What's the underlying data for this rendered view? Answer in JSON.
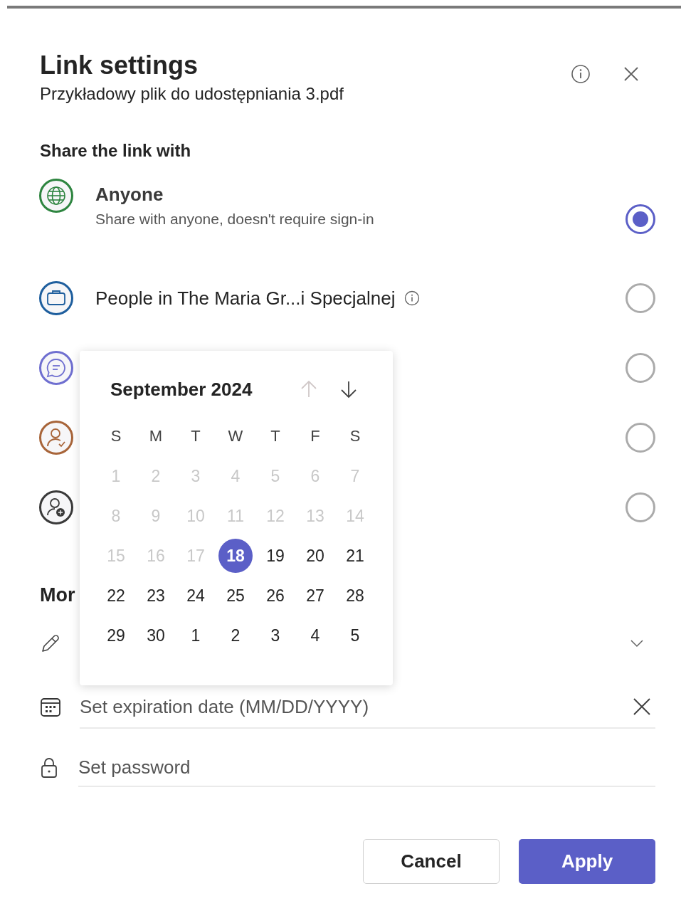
{
  "dialog": {
    "title": "Link settings",
    "subtitle": "Przykładowy plik do udostępniania 3.pdf"
  },
  "share_section": {
    "heading": "Share the link with",
    "options": [
      {
        "kind": "globe",
        "color": "#2e8540",
        "title": "Anyone",
        "description": "Share with anyone, doesn't require sign-in",
        "has_info": false,
        "selected": true
      },
      {
        "kind": "briefcase",
        "color": "#1f5f9e",
        "title": "People in The Maria Gr...i Specjalnej",
        "has_info": true,
        "selected": false
      },
      {
        "kind": "chat",
        "color": "#6f6fd0",
        "selected": false
      },
      {
        "kind": "person",
        "color": "#a8653a",
        "selected": false
      },
      {
        "kind": "people",
        "color": "#3a3a3a",
        "selected": false
      }
    ]
  },
  "more_section": {
    "heading": "Mor"
  },
  "expiration_field": {
    "placeholder": "Set expiration date (MM/DD/YYYY)"
  },
  "password_field": {
    "placeholder": "Set password"
  },
  "calendar": {
    "month": "September 2024",
    "prev_disabled": true,
    "next_disabled": false,
    "weekdays": [
      "S",
      "M",
      "T",
      "W",
      "T",
      "F",
      "S"
    ],
    "weeks": [
      [
        {
          "day": "1",
          "disabled": true,
          "selected": false
        },
        {
          "day": "2",
          "disabled": true,
          "selected": false
        },
        {
          "day": "3",
          "disabled": true,
          "selected": false
        },
        {
          "day": "4",
          "disabled": true,
          "selected": false
        },
        {
          "day": "5",
          "disabled": true,
          "selected": false
        },
        {
          "day": "6",
          "disabled": true,
          "selected": false
        },
        {
          "day": "7",
          "disabled": true,
          "selected": false
        }
      ],
      [
        {
          "day": "8",
          "disabled": true,
          "selected": false
        },
        {
          "day": "9",
          "disabled": true,
          "selected": false
        },
        {
          "day": "10",
          "disabled": true,
          "selected": false
        },
        {
          "day": "11",
          "disabled": true,
          "selected": false
        },
        {
          "day": "12",
          "disabled": true,
          "selected": false
        },
        {
          "day": "13",
          "disabled": true,
          "selected": false
        },
        {
          "day": "14",
          "disabled": true,
          "selected": false
        }
      ],
      [
        {
          "day": "15",
          "disabled": true,
          "selected": false
        },
        {
          "day": "16",
          "disabled": true,
          "selected": false
        },
        {
          "day": "17",
          "disabled": true,
          "selected": false
        },
        {
          "day": "18",
          "disabled": false,
          "selected": true
        },
        {
          "day": "19",
          "disabled": false,
          "selected": false
        },
        {
          "day": "20",
          "disabled": false,
          "selected": false
        },
        {
          "day": "21",
          "disabled": false,
          "selected": false
        }
      ],
      [
        {
          "day": "22",
          "disabled": false,
          "selected": false
        },
        {
          "day": "23",
          "disabled": false,
          "selected": false
        },
        {
          "day": "24",
          "disabled": false,
          "selected": false
        },
        {
          "day": "25",
          "disabled": false,
          "selected": false
        },
        {
          "day": "26",
          "disabled": false,
          "selected": false
        },
        {
          "day": "27",
          "disabled": false,
          "selected": false
        },
        {
          "day": "28",
          "disabled": false,
          "selected": false
        }
      ],
      [
        {
          "day": "29",
          "disabled": false,
          "selected": false
        },
        {
          "day": "30",
          "disabled": false,
          "selected": false
        },
        {
          "day": "1",
          "disabled": false,
          "selected": false
        },
        {
          "day": "2",
          "disabled": false,
          "selected": false
        },
        {
          "day": "3",
          "disabled": false,
          "selected": false
        },
        {
          "day": "4",
          "disabled": false,
          "selected": false
        },
        {
          "day": "5",
          "disabled": false,
          "selected": false
        }
      ]
    ]
  },
  "buttons": [
    {
      "kind": "secondary",
      "label": "Cancel"
    },
    {
      "kind": "primary",
      "label": "Apply"
    }
  ]
}
